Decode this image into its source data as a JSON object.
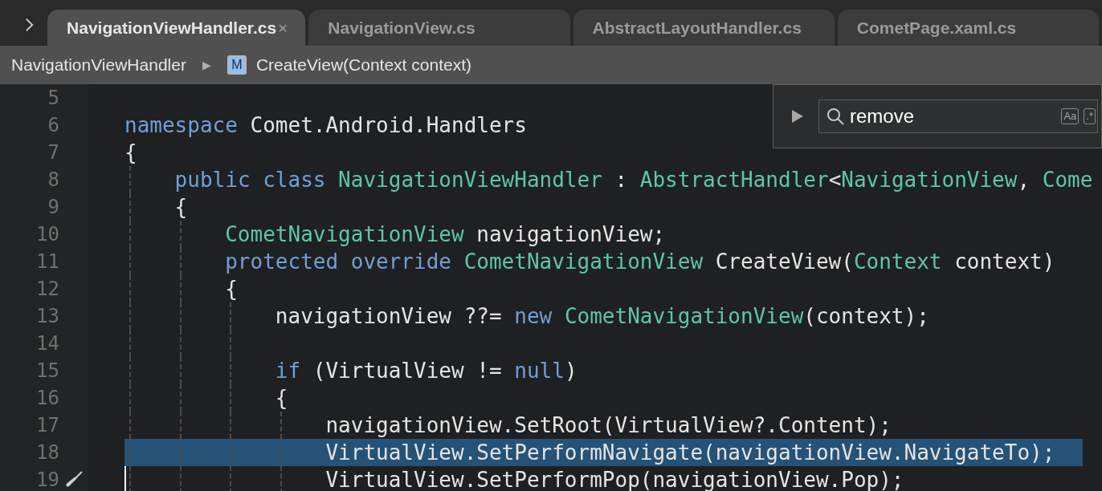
{
  "tabs": [
    {
      "label": "NavigationViewHandler.cs",
      "selected": true,
      "close": "×"
    },
    {
      "label": "NavigationView.cs",
      "selected": false
    },
    {
      "label": "AbstractLayoutHandler.cs",
      "selected": false
    },
    {
      "label": "CometPage.xaml.cs",
      "selected": false
    }
  ],
  "breadcrumb": {
    "class_name": "NavigationViewHandler",
    "separator": "▶",
    "method_badge": "M",
    "method": "CreateView(Context context)"
  },
  "find": {
    "value": "remove",
    "options": [
      {
        "label": "Aa"
      },
      {
        "label": ".*"
      }
    ]
  },
  "lines": [
    {
      "number": "5"
    },
    {
      "number": "6",
      "tokens": [
        {
          "kind": "kw",
          "t": "namespace "
        },
        {
          "kind": "plain",
          "t": "Comet.Android.Handlers"
        }
      ]
    },
    {
      "number": "7",
      "tokens": [
        {
          "kind": "plain",
          "t": "{"
        }
      ],
      "children": [
        {
          "number": "8",
          "tokens": [
            {
              "kind": "kw",
              "t": "public class "
            },
            {
              "kind": "type",
              "t": "NavigationViewHandler"
            },
            {
              "kind": "plain",
              "t": " : "
            },
            {
              "kind": "type",
              "t": "AbstractHandler"
            },
            {
              "kind": "plain",
              "t": "<"
            },
            {
              "kind": "type",
              "t": "NavigationView"
            },
            {
              "kind": "plain",
              "t": ", "
            },
            {
              "kind": "type",
              "t": "Come"
            }
          ]
        },
        {
          "number": "9",
          "tokens": [
            {
              "kind": "plain",
              "t": "{"
            }
          ],
          "children": [
            {
              "number": "10",
              "tokens": [
                {
                  "kind": "type",
                  "t": "CometNavigationView"
                },
                {
                  "kind": "plain",
                  "t": " navigationView;"
                }
              ]
            },
            {
              "number": "11",
              "tokens": [
                {
                  "kind": "kw",
                  "t": "protected override "
                },
                {
                  "kind": "type",
                  "t": "CometNavigationView"
                },
                {
                  "kind": "plain",
                  "t": " CreateView("
                },
                {
                  "kind": "type",
                  "t": "Context"
                },
                {
                  "kind": "plain",
                  "t": " context)"
                }
              ]
            },
            {
              "number": "12",
              "tokens": [
                {
                  "kind": "plain",
                  "t": "{"
                }
              ],
              "children": [
                {
                  "number": "13",
                  "tokens": [
                    {
                      "kind": "plain",
                      "t": "navigationView ??= "
                    },
                    {
                      "kind": "kw",
                      "t": "new "
                    },
                    {
                      "kind": "type",
                      "t": "CometNavigationView"
                    },
                    {
                      "kind": "plain",
                      "t": "(context);"
                    }
                  ]
                },
                {
                  "number": "14"
                },
                {
                  "number": "15",
                  "tokens": [
                    {
                      "kind": "kw",
                      "t": "if"
                    },
                    {
                      "kind": "plain",
                      "t": " (VirtualView != "
                    },
                    {
                      "kind": "kw",
                      "t": "null"
                    },
                    {
                      "kind": "plain",
                      "t": ")"
                    }
                  ]
                },
                {
                  "number": "16",
                  "tokens": [
                    {
                      "kind": "plain",
                      "t": "{"
                    }
                  ],
                  "children": [
                    {
                      "number": "17",
                      "tokens": [
                        {
                          "kind": "plain",
                          "t": "navigationView.SetRoot(VirtualView?.Content);"
                        }
                      ]
                    },
                    {
                      "number": "18",
                      "highlighted": true,
                      "tokens": [
                        {
                          "kind": "plain",
                          "t": "VirtualView.SetPerformNavigate(navigationView.NavigateTo);"
                        }
                      ]
                    },
                    {
                      "number": "19",
                      "action": true,
                      "caret": true,
                      "tokens": [
                        {
                          "kind": "plain",
                          "t": "VirtualView.SetPerformPop(navigationView.Pop);"
                        }
                      ]
                    }
                  ]
                }
              ]
            }
          ]
        }
      ]
    }
  ]
}
